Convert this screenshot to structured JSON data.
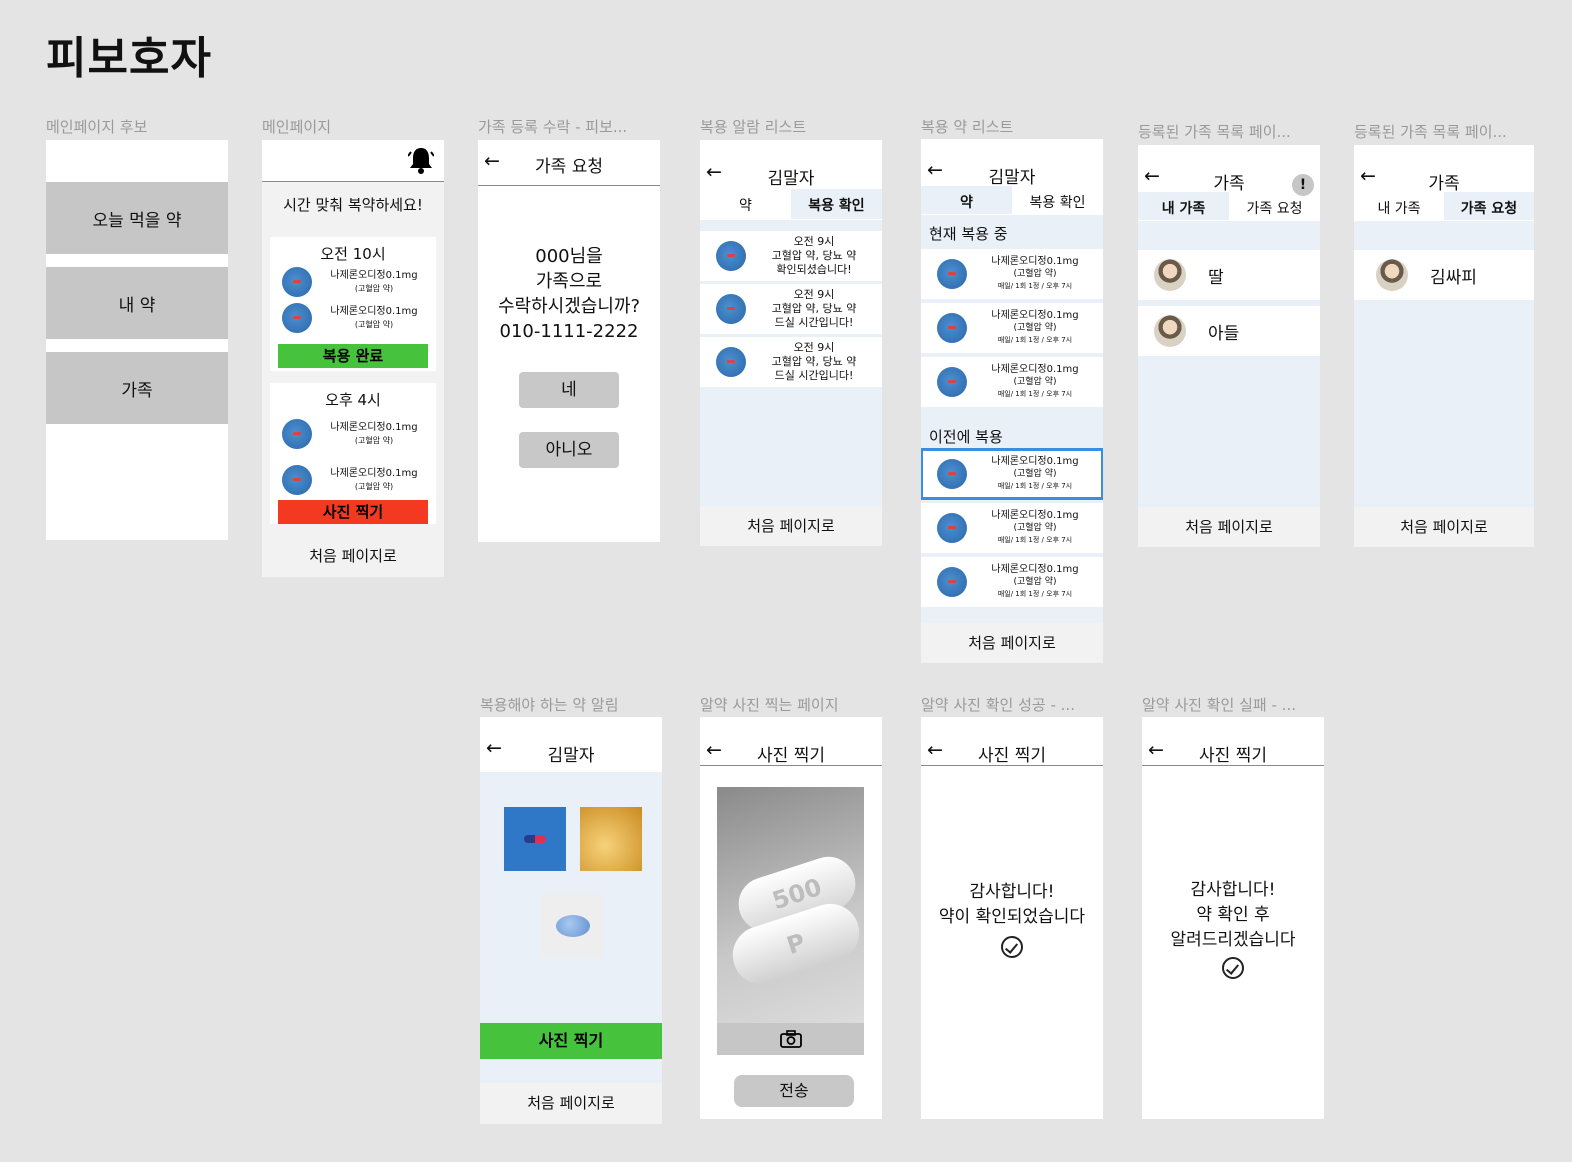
{
  "page_title": "피보호자",
  "frames": {
    "candidate": {
      "label": "메인페이지 후보",
      "buttons": [
        "오늘 먹을 약",
        "내 약",
        "가족"
      ]
    },
    "main": {
      "label": "메인페이지",
      "banner": "시간 맞춰 복약하세요!",
      "slot1": {
        "time": "오전 10시",
        "meds": [
          {
            "name": "나제론오디정0.1mg",
            "sub": "(고혈압 약)"
          },
          {
            "name": "나제론오디정0.1mg",
            "sub": "(고혈압 약)"
          }
        ],
        "button": "복용 완료"
      },
      "slot2": {
        "time": "오후 4시",
        "meds": [
          {
            "name": "나제론오디정0.1mg",
            "sub": "(고혈압 약)"
          },
          {
            "name": "나제론오디정0.1mg",
            "sub": "(고혈압 약)"
          }
        ],
        "button": "사진 찍기"
      },
      "footer": "처음 페이지로"
    },
    "family_accept": {
      "label": "가족 등록 수락 - 피보...",
      "header": "가족 요청",
      "msg1": "000님을",
      "msg2": "가족으로",
      "msg3": "수락하시겠습니까?",
      "phone": "010-1111-2222",
      "yes": "네",
      "no": "아니오"
    },
    "alarm_list": {
      "label": "복용 알람 리스트",
      "header": "김말자",
      "tab1": "약",
      "tab2": "복용 확인",
      "items": [
        {
          "l1": "오전 9시",
          "l2": "고혈압 약, 당뇨 약",
          "l3": "확인되셨습니다!"
        },
        {
          "l1": "오전 9시",
          "l2": "고혈압 약, 당뇨 약",
          "l3": "드실 시간입니다!"
        },
        {
          "l1": "오전 9시",
          "l2": "고혈압 약, 당뇨 약",
          "l3": "드실 시간입니다!"
        }
      ],
      "footer": "처음 페이지로"
    },
    "med_list": {
      "label": "복용 약 리스트",
      "header": "김말자",
      "tab1": "약",
      "tab2": "복용 확인",
      "current": "현재 복용 중",
      "previous": "이전에 복용",
      "med": {
        "name": "나제론오디정0.1mg",
        "sub": "(고혈압 약)",
        "sched": "매일/ 1회 1정 / 오후 7시"
      },
      "footer": "처음 페이지로"
    },
    "family_list1": {
      "label": "등록된 가족 목록 페이...",
      "header": "가족",
      "tab1": "내 가족",
      "tab2": "가족 요청",
      "badge": "!",
      "members": [
        "딸",
        "아들"
      ],
      "footer": "처음 페이지로"
    },
    "family_list2": {
      "label": "등록된 가족 목록 페이...",
      "header": "가족",
      "tab1": "내 가족",
      "tab2": "가족 요청",
      "members": [
        "김싸피"
      ],
      "footer": "처음 페이지로"
    },
    "med_alert": {
      "label": "복용해야 하는 약 알림",
      "header": "김말자",
      "button": "사진 찍기",
      "footer": "처음 페이지로"
    },
    "photo": {
      "label": "알약 사진 찍는 페이지",
      "header": "사진 찍기",
      "pill_mark1": "500",
      "pill_mark2": "P",
      "send": "전송"
    },
    "success": {
      "label": "알약 사진 확인 성공 - ...",
      "header": "사진 찍기",
      "msg1": "감사합니다!",
      "msg2": "약이 확인되었습니다"
    },
    "fail": {
      "label": "알약 사진 확인 실패 - ...",
      "header": "사진 찍기",
      "msg1": "감사합니다!",
      "msg2": "약 확인 후",
      "msg3": "알려드리겠습니다"
    }
  },
  "colors": {
    "accent_green": "#46c23c",
    "accent_red": "#f33a20",
    "highlight_blue": "#3a8de0",
    "panel_blue": "#eaf0f8"
  }
}
